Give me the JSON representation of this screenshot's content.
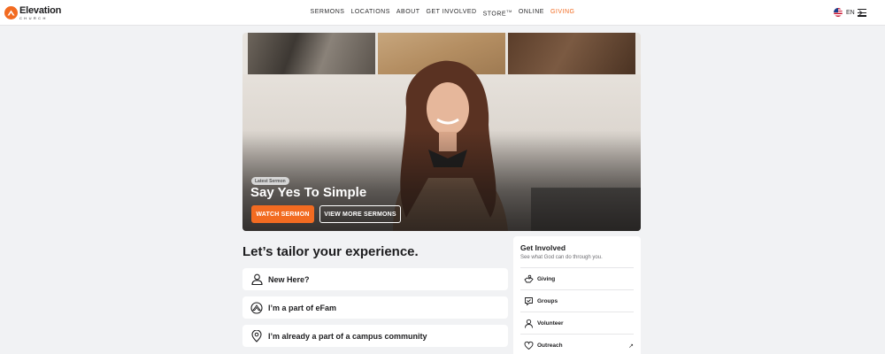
{
  "brand": {
    "name": "Elevation",
    "sub": "CHURCH",
    "accent": "#f26b21"
  },
  "nav": {
    "items": [
      {
        "label": "SERMONS"
      },
      {
        "label": "LOCATIONS"
      },
      {
        "label": "ABOUT"
      },
      {
        "label": "GET INVOLVED"
      },
      {
        "label": "STORE"
      },
      {
        "label": "ONLINE"
      },
      {
        "label": "GIVING",
        "highlight": true
      }
    ],
    "store_mark": "TM",
    "language": "EN",
    "language_icon": "us-flag-icon",
    "menu_icon": "hamburger-menu-icon"
  },
  "hero": {
    "badge": "Latest Sermon",
    "title": "Say Yes To Simple",
    "watch_label": "WATCH SERMON",
    "more_label": "VIEW MORE SERMONS"
  },
  "tailor": {
    "title": "Let’s tailor your experience.",
    "options": [
      {
        "label": "New Here?",
        "icon": "person-icon"
      },
      {
        "label": "I’m a part of eFam",
        "icon": "elevation-logo-icon"
      },
      {
        "label": "I’m already a part of a campus community",
        "icon": "location-pin-icon"
      }
    ]
  },
  "get_involved": {
    "title": "Get Involved",
    "subtitle": "See what God can do through you.",
    "items": [
      {
        "label": "Giving",
        "icon": "giving-hand-icon"
      },
      {
        "label": "Groups",
        "icon": "groups-icon"
      },
      {
        "label": "Volunteer",
        "icon": "volunteer-icon"
      },
      {
        "label": "Outreach",
        "icon": "heart-icon",
        "external": true
      }
    ]
  }
}
